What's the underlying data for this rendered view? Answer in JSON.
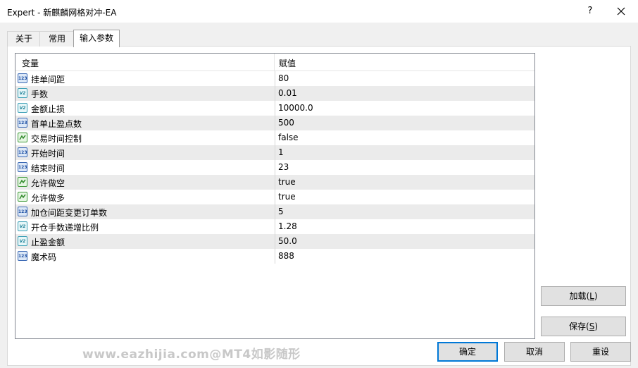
{
  "window": {
    "title": "Expert - 新麒麟网格对冲-EA",
    "help_label": "?"
  },
  "tabs": [
    {
      "label": "关于",
      "active": false
    },
    {
      "label": "常用",
      "active": false
    },
    {
      "label": "输入参数",
      "active": true
    }
  ],
  "grid": {
    "headers": {
      "variable": "变量",
      "value": "赋值"
    },
    "rows": [
      {
        "name": "挂单间距",
        "value": "80",
        "type": "int"
      },
      {
        "name": "手数",
        "value": "0.01",
        "type": "double"
      },
      {
        "name": "金额止损",
        "value": "10000.0",
        "type": "double"
      },
      {
        "name": "首单止盈点数",
        "value": "500",
        "type": "int"
      },
      {
        "name": "交易时间控制",
        "value": "false",
        "type": "bool"
      },
      {
        "name": "开始时间",
        "value": "1",
        "type": "int"
      },
      {
        "name": "结束时间",
        "value": "23",
        "type": "int"
      },
      {
        "name": "允许做空",
        "value": "true",
        "type": "bool"
      },
      {
        "name": "允许做多",
        "value": "true",
        "type": "bool"
      },
      {
        "name": "加仓间距变更订单数",
        "value": "5",
        "type": "int"
      },
      {
        "name": "开仓手数递增比例",
        "value": "1.28",
        "type": "double"
      },
      {
        "name": "止盈金额",
        "value": "50.0",
        "type": "double"
      },
      {
        "name": "魔术码",
        "value": "888",
        "type": "int"
      }
    ]
  },
  "icons": {
    "int": "123",
    "double": "V2",
    "bool": "bool-chart-icon"
  },
  "side_buttons": {
    "load": {
      "label": "加载(",
      "key": "L",
      "end": ")"
    },
    "save": {
      "label": "保存(",
      "key": "S",
      "end": ")"
    }
  },
  "footer_buttons": {
    "ok": "确定",
    "cancel": "取消",
    "reset": "重设"
  },
  "watermark": "www.eazhijia.com@MT4如影随形",
  "colors": {
    "default_button_border": "#0078d7",
    "row_alt": "#ebebeb"
  }
}
